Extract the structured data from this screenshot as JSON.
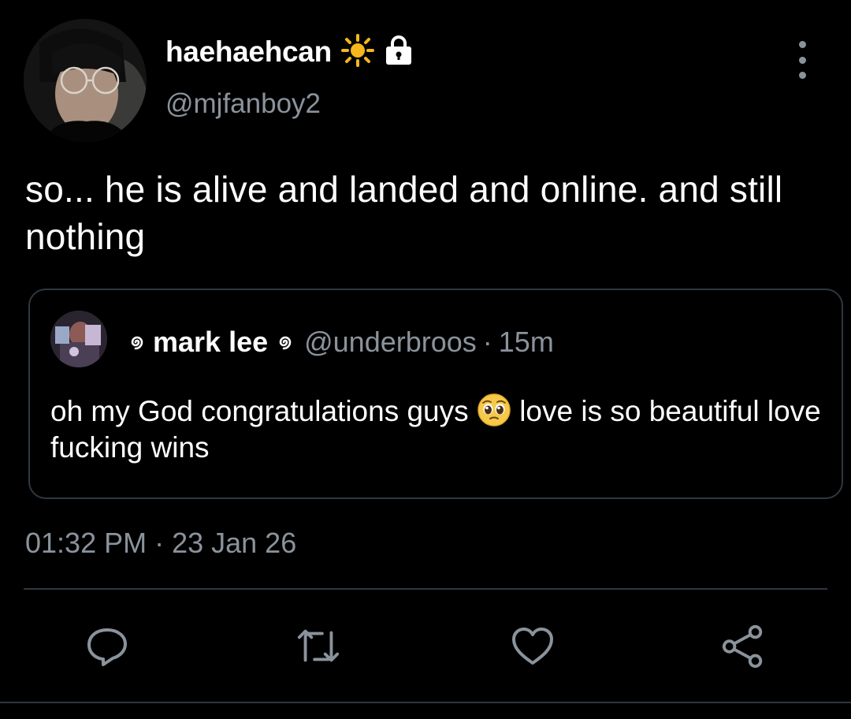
{
  "author": {
    "display_name": "haehaehcan",
    "handle": "@mjfanboy2",
    "name_icons": [
      "sun-icon",
      "lock-icon"
    ]
  },
  "tweet": {
    "text": "so... he is alive and landed and online. and still nothing"
  },
  "quoted": {
    "name": "mark lee",
    "handle": "@underbroos",
    "separator": "·",
    "time": "15m",
    "text_part1": "oh my God congratulations guys ",
    "text_part2": " love is so beautiful love fucking wins",
    "emoji": "pleading-face-emoji"
  },
  "meta": {
    "timestamp": "01:32 PM · 23 Jan 26"
  },
  "actions": [
    "reply-icon",
    "retweet-icon",
    "like-icon",
    "share-icon"
  ],
  "colors": {
    "background": "#000000",
    "text": "#ffffff",
    "secondary": "#8a939c",
    "border": "#2f3740"
  }
}
